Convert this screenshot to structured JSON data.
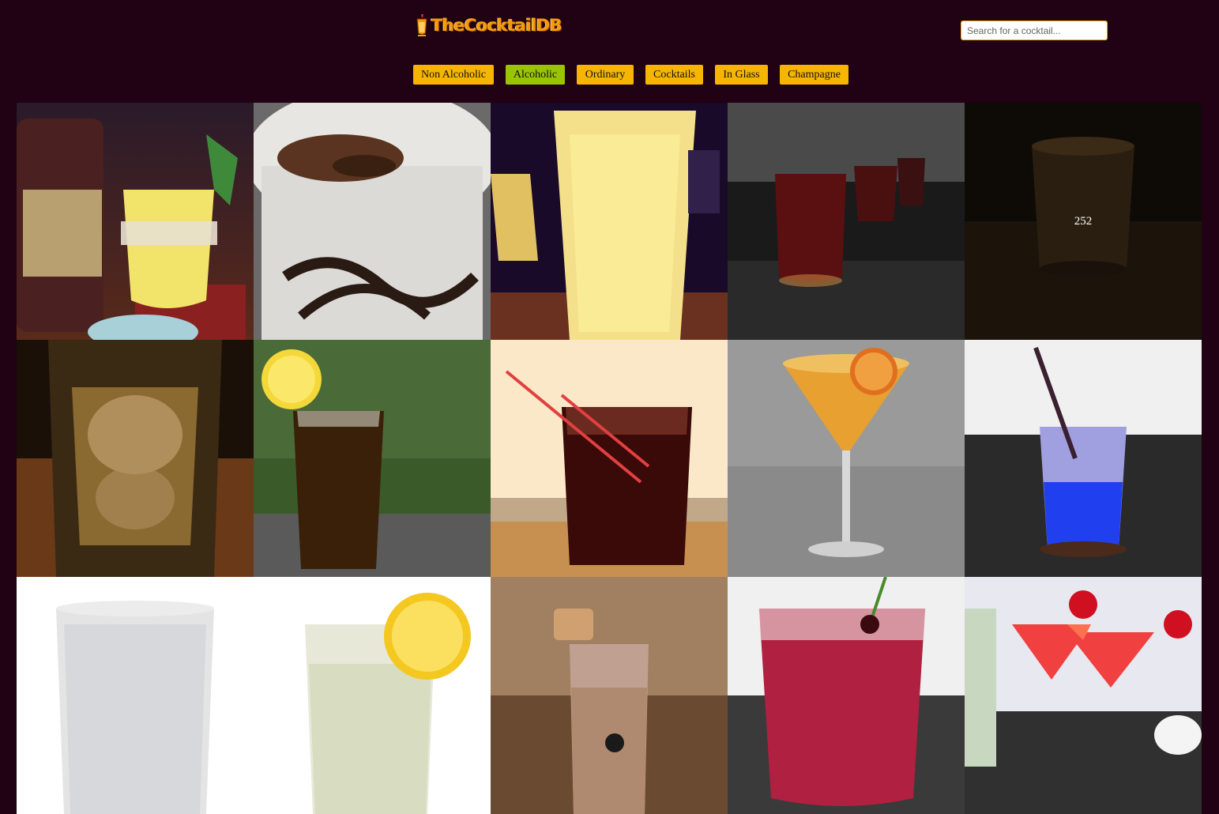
{
  "header": {
    "logo_text": "TheCocktailDB",
    "search_placeholder": "Search for a cocktail..."
  },
  "nav": {
    "items": [
      {
        "label": "Non Alcoholic",
        "active": false
      },
      {
        "label": "Alcoholic",
        "active": true
      },
      {
        "label": "Ordinary",
        "active": false
      },
      {
        "label": "Cocktails",
        "active": false
      },
      {
        "label": "In Glass",
        "active": false
      },
      {
        "label": "Champagne",
        "active": false
      }
    ]
  },
  "grid": {
    "hovered_tile_label": "252"
  },
  "colors": {
    "background": "#200214",
    "button": "#f7b500",
    "button_active": "#99c400",
    "logo": "#f59a0b"
  }
}
